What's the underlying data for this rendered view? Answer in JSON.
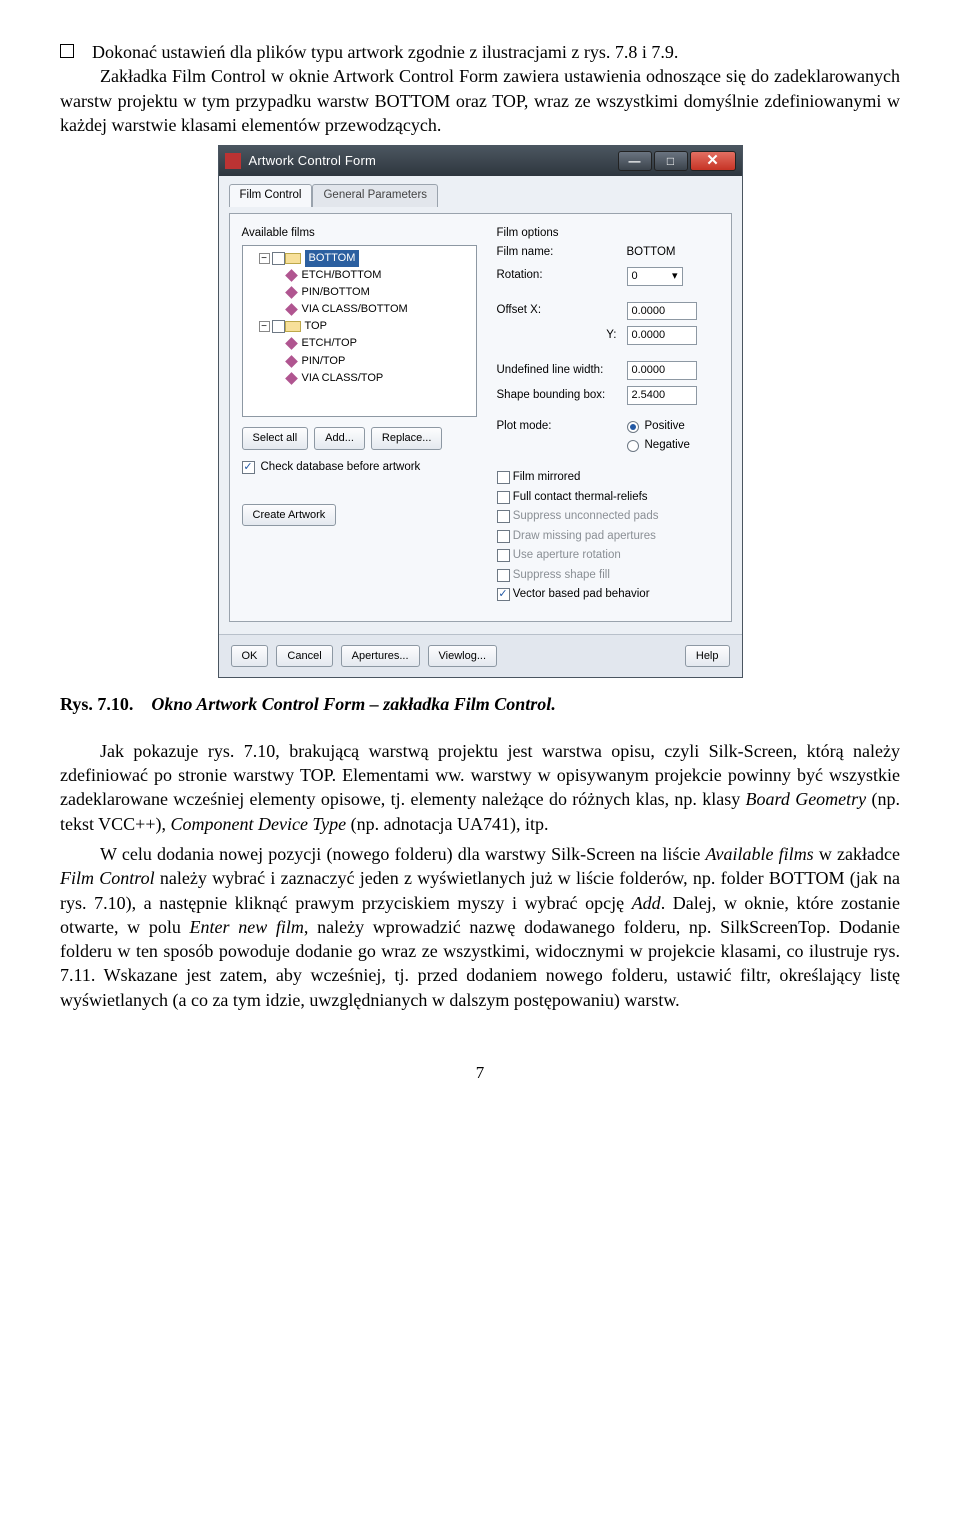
{
  "doc": {
    "bullet_text": "Dokonać ustawień dla plików typu artwork zgodnie z ilustracjami z rys. 7.8 i 7.9.",
    "intro_para": "Zakładka Film Control w oknie Artwork Control Form zawiera ustawienia odnoszące się do zadeklarowanych warstw projektu w tym przypadku warstw BOTTOM oraz TOP, wraz ze wszystkimi domyślnie zdefiniowanymi w każdej warstwie klasami elementów przewodzących.",
    "caption_label": "Rys. 7.10.",
    "caption_text": "Okno Artwork Control Form – zakładka Film Control.",
    "p1_a": "Jak pokazuje rys. 7.10, brakującą warstwą projektu jest warstwa opisu, czyli Silk-Screen, którą należy zdefiniować po stronie warstwy TOP. Elementami ww. warstwy w opisywanym projekcie powinny być wszystkie zadeklarowane wcześniej elementy opisowe, tj. elementy należące do różnych klas, np. klasy ",
    "p1_b": " (np. tekst VCC++), ",
    "p1_c": " (np. adnotacja UA741), itp.",
    "italic_bg": "Board Geometry",
    "italic_cdt": "Component Device Type",
    "p2_a": "W celu dodania nowej pozycji (nowego folderu) dla warstwy Silk-Screen na liście ",
    "italic_af": "Available films",
    "p2_b": " w zakładce ",
    "italic_fc": "Film Control",
    "p2_c": " należy wybrać i zaznaczyć jeden z wyświetlanych już w liście folderów, np. folder BOTTOM (jak na rys. 7.10), a następnie kliknąć prawym przyciskiem myszy i wybrać opcję ",
    "italic_add": "Add",
    "p2_d": ". Dalej, w oknie, które zostanie otwarte, w polu ",
    "italic_enf": "Enter new film",
    "p2_e": ", należy wprowadzić nazwę dodawanego folderu, np. SilkScreenTop. Dodanie folderu w ten sposób powoduje dodanie go wraz ze wszystkimi, widocznymi w projekcie klasami, co ilustruje rys. 7.11. Wskazane jest zatem, aby wcześniej, tj. przed dodaniem nowego folderu, ustawić filtr, określający listę wyświetlanych (a co za tym idzie, uwzględnianych w dalszym postępowaniu) warstw.",
    "page": "7"
  },
  "dlg": {
    "title": "Artwork Control Form",
    "tabs": {
      "film": "Film Control",
      "general": "General Parameters"
    },
    "available_label": "Available films",
    "tree": {
      "bottom": "BOTTOM",
      "etch_bottom": "ETCH/BOTTOM",
      "pin_bottom": "PIN/BOTTOM",
      "via_bottom": "VIA CLASS/BOTTOM",
      "top": "TOP",
      "etch_top": "ETCH/TOP",
      "pin_top": "PIN/TOP",
      "via_top": "VIA CLASS/TOP"
    },
    "btns": {
      "select_all": "Select all",
      "add": "Add...",
      "replace": "Replace..."
    },
    "chk_db": "Check database before artwork",
    "create": "Create Artwork",
    "film_options_label": "Film options",
    "fields": {
      "film_name_l": "Film name:",
      "film_name_v": "BOTTOM",
      "rotation_l": "Rotation:",
      "rotation_v": "0",
      "offx_l": "Offset  X:",
      "offx_v": "0.0000",
      "offy_l": "Y:",
      "offy_v": "0.0000",
      "ulw_l": "Undefined line width:",
      "ulw_v": "0.0000",
      "sbb_l": "Shape bounding box:",
      "sbb_v": "2.5400",
      "plot_l": "Plot mode:",
      "pos": "Positive",
      "neg": "Negative"
    },
    "checks": {
      "mirrored": "Film mirrored",
      "thermal": "Full contact thermal-reliefs",
      "suppress_pads": "Suppress unconnected pads",
      "draw_missing": "Draw missing pad apertures",
      "aperture_rot": "Use aperture rotation",
      "suppress_shape": "Suppress shape fill",
      "vector": "Vector based pad behavior"
    },
    "bottom": {
      "ok": "OK",
      "cancel": "Cancel",
      "apertures": "Apertures...",
      "viewlog": "Viewlog...",
      "help": "Help"
    },
    "glyphs": {
      "min": "—",
      "max": "□",
      "close": "✕",
      "caret": "▾",
      "check": "✓",
      "minus": "−"
    }
  }
}
